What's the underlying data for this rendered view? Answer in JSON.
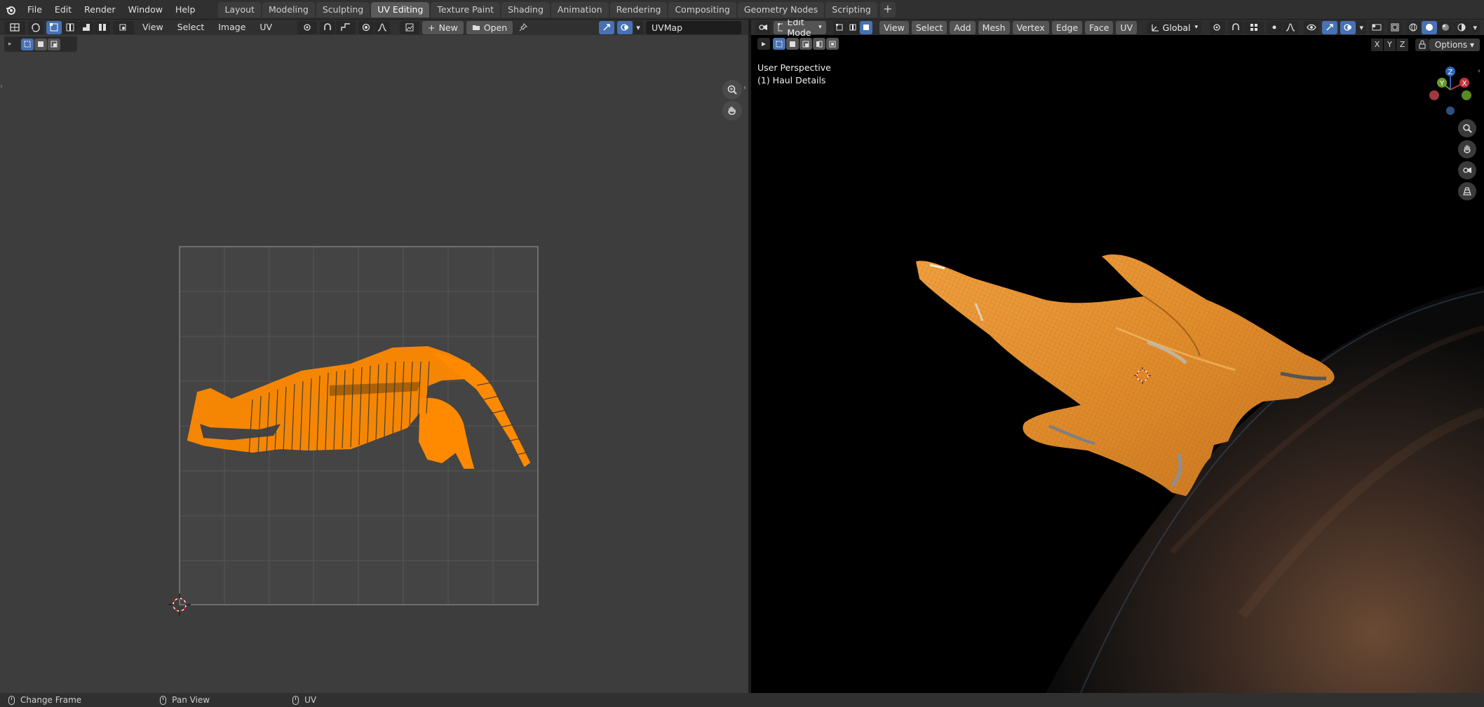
{
  "top_menu": [
    "File",
    "Edit",
    "Render",
    "Window",
    "Help"
  ],
  "workspace_tabs": [
    {
      "label": "Layout",
      "active": false
    },
    {
      "label": "Modeling",
      "active": false
    },
    {
      "label": "Sculpting",
      "active": false
    },
    {
      "label": "UV Editing",
      "active": true
    },
    {
      "label": "Texture Paint",
      "active": false
    },
    {
      "label": "Shading",
      "active": false
    },
    {
      "label": "Animation",
      "active": false
    },
    {
      "label": "Rendering",
      "active": false
    },
    {
      "label": "Compositing",
      "active": false
    },
    {
      "label": "Geometry Nodes",
      "active": false
    },
    {
      "label": "Scripting",
      "active": false
    }
  ],
  "uv_editor": {
    "menus": [
      "View",
      "Select",
      "Image",
      "UV"
    ],
    "new_label": "New",
    "open_label": "Open",
    "uv_map_name": "UVMap"
  },
  "viewport": {
    "mode": "Edit Mode",
    "menus": [
      "View",
      "Select",
      "Add",
      "Mesh",
      "Vertex",
      "Edge",
      "Face",
      "UV"
    ],
    "orientation": "Global",
    "perspective_label": "User Perspective",
    "object_label": "(1) Haul Details",
    "axis_buttons": [
      "X",
      "Y",
      "Z"
    ],
    "options_label": "Options",
    "gizmo_axes": {
      "x": "X",
      "y": "Y",
      "z": "Z"
    }
  },
  "colors": {
    "accent_blue": "#4772b3",
    "uv_orange": "#ff8a00",
    "mesh_orange": "#e89a3a"
  },
  "status_bar": [
    {
      "icon": "mouse-left-icon",
      "label": "Change Frame"
    },
    {
      "icon": "mouse-middle-icon",
      "label": "Pan View"
    },
    {
      "icon": "mouse-right-icon",
      "label": "UV"
    }
  ]
}
